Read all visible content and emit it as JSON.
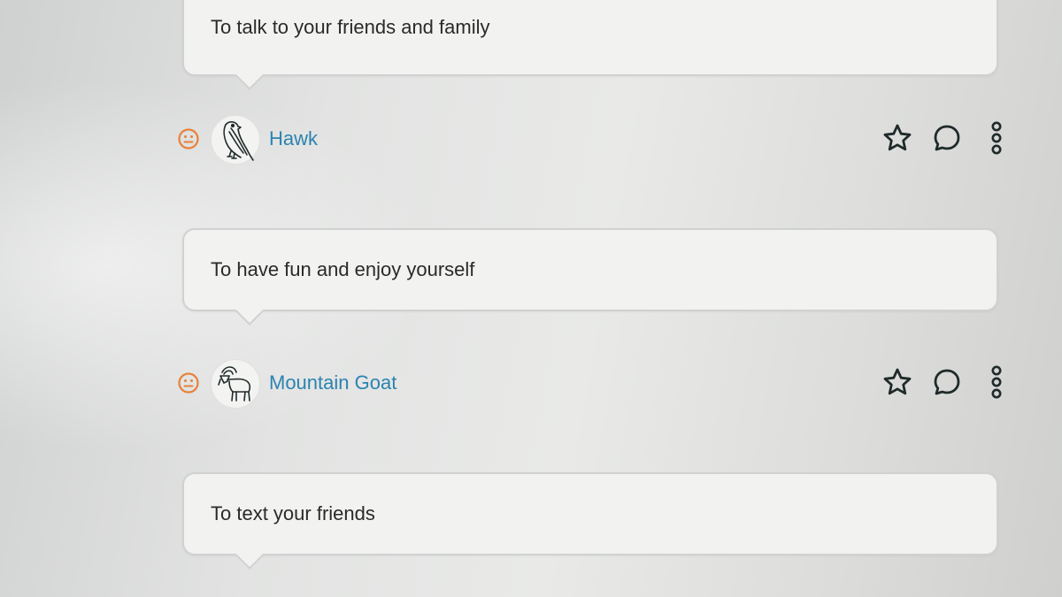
{
  "messages": [
    {
      "text": "To talk to your friends and family"
    },
    {
      "text": "To have fun and enjoy yourself"
    },
    {
      "text": "To text your friends"
    }
  ],
  "users": [
    {
      "name": "Hawk",
      "avatar_icon": "hawk-icon",
      "mood_icon": "neutral-face-icon"
    },
    {
      "name": "Mountain Goat",
      "avatar_icon": "mountain-goat-icon",
      "mood_icon": "neutral-face-icon"
    }
  ],
  "actions": [
    {
      "icon": "star-icon"
    },
    {
      "icon": "comment-icon"
    },
    {
      "icon": "more-vertical-icon"
    }
  ],
  "colors": {
    "username": "#2b83b0",
    "mood": "#e8813a",
    "icon_stroke": "#1f2a2a",
    "bubble_bg": "#f2f2f1",
    "bubble_border": "#d0d2d1"
  }
}
